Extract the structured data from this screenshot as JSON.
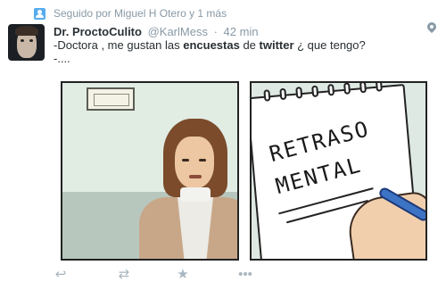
{
  "tweet": {
    "context": "Seguido por Miguel H Otero y 1 más",
    "author": {
      "name": "Dr. ProctoCulito",
      "handle": "@KarlMess"
    },
    "separator": "·",
    "time": "42 min",
    "text": {
      "line1_start": "-Doctora , me gustan las ",
      "bold1": "encuestas",
      "mid": " de ",
      "bold2": "twitter",
      "end": " ¿ que tengo?",
      "line2": "-...."
    },
    "image": {
      "notepad_text_line1": "RETRASO",
      "notepad_text_line2": "MENTAL"
    },
    "actions": {
      "reply_icon": "reply-icon",
      "retweet_icon": "retweet-icon",
      "favorite_icon": "star-icon",
      "more_icon": "more-dots-icon"
    }
  },
  "colors": {
    "meta": "#8899a6",
    "text": "#292f33",
    "accent": "#55acee",
    "action": "#a8b6c0"
  }
}
